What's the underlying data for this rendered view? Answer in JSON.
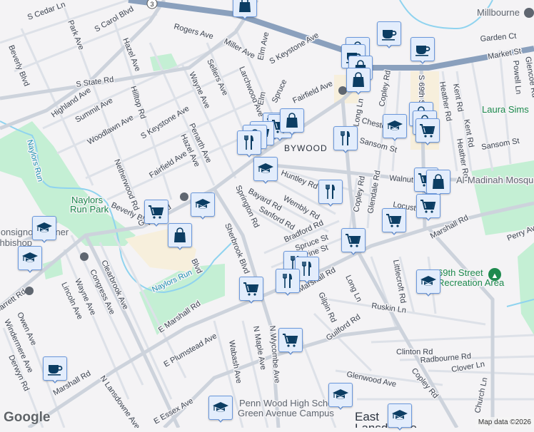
{
  "map": {
    "route_shield": "3",
    "labels": [
      {
        "text": "S Cedar Ln",
        "kind": "road"
      },
      {
        "text": "Park Ave",
        "kind": "road"
      },
      {
        "text": "S Carol Blvd",
        "kind": "road"
      },
      {
        "text": "Beverly Blvd",
        "kind": "road"
      },
      {
        "text": "Hazel Ave",
        "kind": "road"
      },
      {
        "text": "Rogers Ave",
        "kind": "road"
      },
      {
        "text": "Miller Ave",
        "kind": "road"
      },
      {
        "text": "Elm Ave",
        "kind": "road"
      },
      {
        "text": "S State Rd",
        "kind": "road"
      },
      {
        "text": "Sellers Ave",
        "kind": "road"
      },
      {
        "text": "Wayne Ave",
        "kind": "road"
      },
      {
        "text": "Larchwood Ave",
        "kind": "road"
      },
      {
        "text": "Highland Ave",
        "kind": "road"
      },
      {
        "text": "Summit Ave",
        "kind": "road"
      },
      {
        "text": "Hilltop Rd",
        "kind": "road"
      },
      {
        "text": "Woodlawn Ave",
        "kind": "road"
      },
      {
        "text": "S Keystone Ave",
        "kind": "road"
      },
      {
        "text": "Penarth Ave",
        "kind": "road"
      },
      {
        "text": "Hazel Ave",
        "kind": "road"
      },
      {
        "text": "Fairfield Ave",
        "kind": "road"
      },
      {
        "text": "Netherwood Rd",
        "kind": "road"
      },
      {
        "text": "Naylors",
        "kind": "park"
      },
      {
        "text": "Run Park",
        "kind": "park"
      },
      {
        "text": "Naylors Run",
        "kind": "water"
      },
      {
        "text": "Beverly Blvd",
        "kind": "road"
      },
      {
        "text": "S Keystone Ave",
        "kind": "road"
      },
      {
        "text": "Spruce",
        "kind": "road"
      },
      {
        "text": "Elm",
        "kind": "road"
      },
      {
        "text": "Fairfield Ave",
        "kind": "road"
      },
      {
        "text": "Copley Rd",
        "kind": "road"
      },
      {
        "text": "S 69th St",
        "kind": "road"
      },
      {
        "text": "Heather Rd",
        "kind": "road"
      },
      {
        "text": "Kent Rd",
        "kind": "road"
      },
      {
        "text": "Market St",
        "kind": "road"
      },
      {
        "text": "Powell Ln",
        "kind": "road"
      },
      {
        "text": "Glencoe Rd",
        "kind": "road"
      },
      {
        "text": "Garden Ct",
        "kind": "road"
      },
      {
        "text": "Millbourne",
        "kind": "poi"
      },
      {
        "text": "Laura Sims",
        "kind": "park"
      },
      {
        "text": "Kent Rd",
        "kind": "road"
      },
      {
        "text": "Heather Rd",
        "kind": "road"
      },
      {
        "text": "Sansom St",
        "kind": "road"
      },
      {
        "text": "Sansom St",
        "kind": "road"
      },
      {
        "text": "Long Ln",
        "kind": "road"
      },
      {
        "text": "Chester",
        "kind": "road"
      },
      {
        "text": "BYWOOD",
        "kind": "place"
      },
      {
        "text": "Huntley Rd",
        "kind": "road"
      },
      {
        "text": "Walnut St",
        "kind": "road"
      },
      {
        "text": "Al-Madinah Mosque",
        "kind": "poi"
      },
      {
        "text": "Bayard Rd",
        "kind": "road"
      },
      {
        "text": "Wembly Rd",
        "kind": "road"
      },
      {
        "text": "Sanford Rd",
        "kind": "road"
      },
      {
        "text": "Springton Rd",
        "kind": "road"
      },
      {
        "text": "Copley Rd",
        "kind": "road"
      },
      {
        "text": "Glendale Rd",
        "kind": "road"
      },
      {
        "text": "Locust St",
        "kind": "road"
      },
      {
        "text": "Bradford Rd",
        "kind": "road"
      },
      {
        "text": "Spruce St",
        "kind": "road"
      },
      {
        "text": "Pine St",
        "kind": "road"
      },
      {
        "text": "Marshall Rd",
        "kind": "road"
      },
      {
        "text": "Perry Ave",
        "kind": "road"
      },
      {
        "text": "Sherbrook Blvd",
        "kind": "road"
      },
      {
        "text": "Marshall Rd",
        "kind": "road"
      },
      {
        "text": "Long Ln",
        "kind": "road"
      },
      {
        "text": "Gilpin Rd",
        "kind": "road"
      },
      {
        "text": "Littlecroft Rd",
        "kind": "road"
      },
      {
        "text": "69th Street",
        "kind": "park"
      },
      {
        "text": "Recreation Area",
        "kind": "park"
      },
      {
        "text": "Ruskin Ln",
        "kind": "road"
      },
      {
        "text": "Guilford Rd",
        "kind": "road"
      },
      {
        "text": "N Wycombe Ave",
        "kind": "road"
      },
      {
        "text": "Clinton Rd",
        "kind": "road"
      },
      {
        "text": "Radbourne Rd",
        "kind": "road"
      },
      {
        "text": "Clover Ln",
        "kind": "road"
      },
      {
        "text": "Copley Rd",
        "kind": "road"
      },
      {
        "text": "Church Ln",
        "kind": "road"
      },
      {
        "text": "Glenwood Ave",
        "kind": "road"
      },
      {
        "text": "Penn Wood High School",
        "kind": "poi"
      },
      {
        "text": "Green Avenue Campus",
        "kind": "poi"
      },
      {
        "text": "East",
        "kind": "town"
      },
      {
        "text": "Lansdowne",
        "kind": "town"
      },
      {
        "text": "E Marshall Rd",
        "kind": "road"
      },
      {
        "text": "E Plumstead Ave",
        "kind": "road"
      },
      {
        "text": "Wabash Ave",
        "kind": "road"
      },
      {
        "text": "N Maple Ave",
        "kind": "road"
      },
      {
        "text": "N Lansdowne Ave",
        "kind": "road"
      },
      {
        "text": "Marshall Rd",
        "kind": "road"
      },
      {
        "text": "E Essex Ave",
        "kind": "road"
      },
      {
        "text": "Owen Ave",
        "kind": "road"
      },
      {
        "text": "Windermere Ave",
        "kind": "road"
      },
      {
        "text": "Derwyn Rd",
        "kind": "road"
      },
      {
        "text": "Lincoln Ave",
        "kind": "road"
      },
      {
        "text": "Wayne Ave",
        "kind": "road"
      },
      {
        "text": "Congress Ave",
        "kind": "road"
      },
      {
        "text": "Clearbrook Ave",
        "kind": "road"
      },
      {
        "text": "Naylors Run",
        "kind": "water"
      },
      {
        "text": "Garrett Rd",
        "kind": "road"
      },
      {
        "text": "Monsignor Bonner",
        "kind": "poi"
      },
      {
        "text": "Archbishop",
        "kind": "poi"
      },
      {
        "text": "Blvd",
        "kind": "road"
      },
      {
        "text": "Garrett Rd",
        "kind": "road"
      }
    ],
    "markers": [
      {
        "type": "shopping"
      },
      {
        "type": "coffee"
      },
      {
        "type": "coffee"
      },
      {
        "type": "shopping"
      },
      {
        "type": "coffee"
      },
      {
        "type": "shopping"
      },
      {
        "type": "shopping"
      },
      {
        "type": "grocery"
      },
      {
        "type": "grocery"
      },
      {
        "type": "shopping"
      },
      {
        "type": "grocery"
      },
      {
        "type": "shopping"
      },
      {
        "type": "restaurant"
      },
      {
        "type": "restaurant"
      },
      {
        "type": "school"
      },
      {
        "type": "shopping"
      },
      {
        "type": "shopping"
      },
      {
        "type": "grocery"
      },
      {
        "type": "school"
      },
      {
        "type": "restaurant"
      },
      {
        "type": "grocery"
      },
      {
        "type": "shopping"
      },
      {
        "type": "grocery"
      },
      {
        "type": "grocery"
      },
      {
        "type": "grocery"
      },
      {
        "type": "grocery"
      },
      {
        "type": "school"
      },
      {
        "type": "shopping"
      },
      {
        "type": "school"
      },
      {
        "type": "school"
      },
      {
        "type": "restaurant"
      },
      {
        "type": "restaurant"
      },
      {
        "type": "restaurant"
      },
      {
        "type": "grocery"
      },
      {
        "type": "school"
      },
      {
        "type": "grocery"
      },
      {
        "type": "coffee"
      },
      {
        "type": "school"
      },
      {
        "type": "school"
      },
      {
        "type": "school"
      }
    ],
    "colors": {
      "highway": "#8aa0bd",
      "park": "#c4efd4",
      "water": "#8fd3ef",
      "commercial": "#f7efdc",
      "icon": "#0b3d63",
      "marker_bg": "#e3edfc"
    }
  },
  "footer": {
    "logo": "Google",
    "attribution": "Map data ©2026"
  }
}
